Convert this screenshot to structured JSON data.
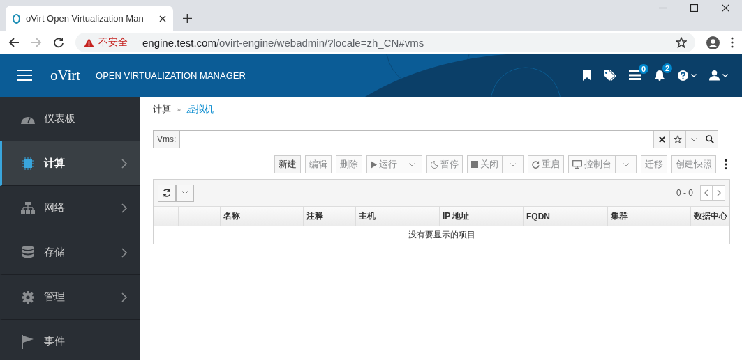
{
  "browser": {
    "tab_title": "oVirt Open Virtualization Man",
    "security": "不安全",
    "url_host": "engine.test.com",
    "url_path": "/ovirt-engine/webadmin/?locale=zh_CN#vms"
  },
  "header": {
    "logo": "oVirt",
    "title": "OPEN VIRTUALIZATION MANAGER",
    "icons": [
      {
        "kind": "bookmark"
      },
      {
        "kind": "tag"
      },
      {
        "kind": "tasks",
        "badge": "0"
      },
      {
        "kind": "bell",
        "badge": "2"
      },
      {
        "kind": "help",
        "dropdown": true
      },
      {
        "kind": "user",
        "dropdown": true
      }
    ]
  },
  "sidebar": {
    "items": [
      {
        "kind": "dashboard",
        "label": "仪表板",
        "selected": false,
        "expandable": false
      },
      {
        "kind": "chip",
        "label": "计算",
        "selected": true,
        "expandable": true
      },
      {
        "kind": "network",
        "label": "网络",
        "selected": false,
        "expandable": true
      },
      {
        "kind": "storage",
        "label": "存储",
        "selected": false,
        "expandable": true
      },
      {
        "kind": "gear",
        "label": "管理",
        "selected": false,
        "expandable": true
      },
      {
        "kind": "flag",
        "label": "事件",
        "selected": false,
        "expandable": false
      }
    ]
  },
  "breadcrumb": {
    "separator": "»",
    "items": [
      {
        "label": "计算",
        "link": false
      },
      {
        "label": "虚拟机",
        "link": true
      }
    ]
  },
  "search": {
    "label": "Vms:"
  },
  "toolbar": [
    {
      "kind": "text",
      "label": "新建",
      "disabled": false,
      "dropdown": false
    },
    {
      "kind": "text",
      "label": "编辑",
      "disabled": true,
      "dropdown": false
    },
    {
      "kind": "text",
      "label": "删除",
      "disabled": true,
      "dropdown": false
    },
    {
      "kind": "play",
      "label": "运行",
      "disabled": true,
      "dropdown": true
    },
    {
      "kind": "pause",
      "label": "暂停",
      "disabled": true,
      "dropdown": false
    },
    {
      "kind": "stop",
      "label": "关闭",
      "disabled": true,
      "dropdown": true
    },
    {
      "kind": "restart",
      "label": "重启",
      "disabled": true,
      "dropdown": false
    },
    {
      "kind": "console",
      "label": "控制台",
      "disabled": true,
      "dropdown": true
    },
    {
      "kind": "text",
      "label": "迁移",
      "disabled": true,
      "dropdown": false
    },
    {
      "kind": "text",
      "label": "创建快照",
      "disabled": true,
      "dropdown": false
    }
  ],
  "table": {
    "pagination": "0 - 0",
    "columns": [
      "",
      "",
      "名称",
      "注释",
      "主机",
      "IP 地址",
      "FQDN",
      "集群",
      "数据中心"
    ],
    "empty_message": "没有要显示的项目"
  }
}
